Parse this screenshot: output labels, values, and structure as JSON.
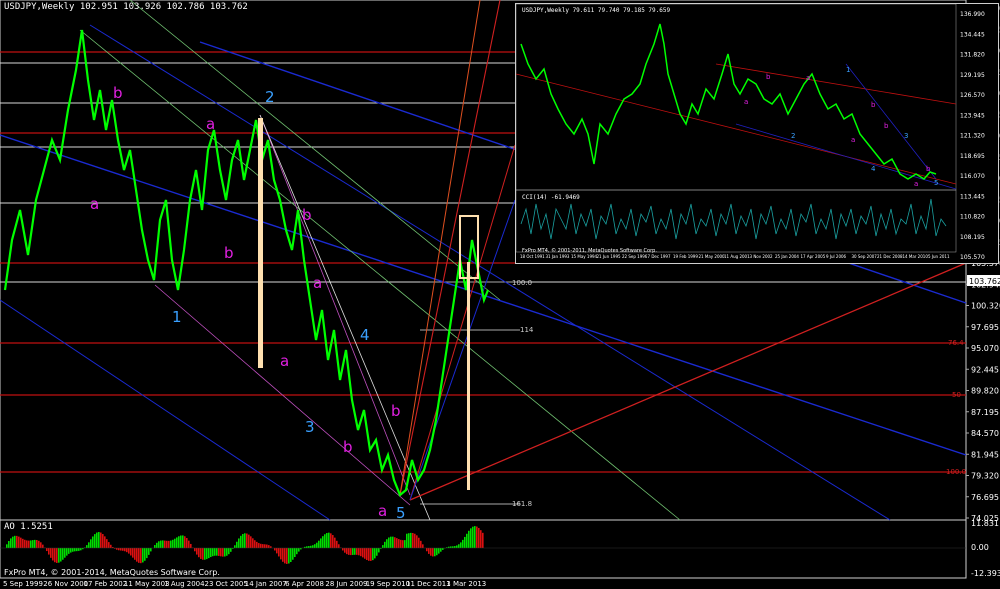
{
  "window": {
    "title": "USDJPY,Weekly  102.951 103.926 102.786 103.762"
  },
  "price_axis": {
    "labels": [
      "136.990",
      "134.445",
      "131.820",
      "129.195",
      "126.570",
      "123.945",
      "121.320",
      "118.695",
      "116.070",
      "113.445",
      "110.820",
      "108.195",
      "105.570",
      "102.945",
      "100.320",
      "97.695",
      "95.070",
      "92.445",
      "89.820",
      "87.195",
      "84.570",
      "81.945",
      "79.320",
      "76.695",
      "74.025"
    ],
    "current_price": "103.762",
    "current_price_color": "#ffffff"
  },
  "ao_axis": {
    "labels": [
      "11.831",
      "0.00",
      "-12.3935"
    ]
  },
  "time_axis": {
    "labels": [
      "5 Sep 1999",
      "26 Nov 2000",
      "17 Feb 2002",
      "11 May 2003",
      "1 Aug 2004",
      "23 Oct 2005",
      "14 Jan 2007",
      "6 Apr 2008",
      "28 Jun 2009",
      "19 Sep 2010",
      "11 Dec 2011",
      "3 Mar 2013"
    ]
  },
  "indicator": {
    "title": "AO 1.5251"
  },
  "footer": {
    "copyright": "FxPro MT4, © 2001-2014, MetaQuotes Software Corp."
  },
  "fib_levels": {
    "level_100": "100.0",
    "level_114": "114",
    "level_76": "76.4",
    "level_61": "61.8",
    "level_50": "50",
    "level_100b": "100.0",
    "level_161": "161.8"
  },
  "wave_labels": {
    "w1": "1",
    "w2": "2",
    "w3": "3",
    "w4": "4",
    "w5": "5",
    "a1": "a",
    "a2": "a",
    "a3": "a",
    "a4": "a",
    "b1": "b",
    "b2": "b",
    "b3": "b",
    "b4": "b",
    "b5": "b"
  },
  "inset": {
    "title": "USDJPY,Weekly  79.611 79.740 79.185 79.659",
    "cci_title": "CCI(14) -61.9469",
    "copyright": "FxPro MT4, © 2001-2011, MetaQuotes Software Corp.",
    "price_labels": [
      "136.990",
      "134.445",
      "131.820",
      "129.195",
      "126.570",
      "123.945",
      "121.320",
      "118.695",
      "116.070",
      "113.445",
      "110.820",
      "108.195",
      "105.570"
    ],
    "time_labels": [
      "18 Oct 1991",
      "31 Jan 1993",
      "15 May 1994",
      "21 Jun 1995",
      "22 Sep 1996",
      "7 Dec 1997",
      "19 Feb 1999",
      "21 May 2000",
      "11 Aug 2001",
      "3 Nov 2002",
      "25 Jan 2004",
      "17 Apr 2005",
      "9 Jul 2006",
      "30 Sep 2007",
      "21 Dec 2008",
      "14 Mar 2010",
      "5 Jun 2011"
    ],
    "wave_labels": [
      "1",
      "2",
      "3",
      "4",
      "5",
      "a",
      "b",
      "a",
      "b",
      "a",
      "b",
      "a",
      "b"
    ]
  },
  "colors": {
    "background": "#000000",
    "candles": "#00ff00",
    "red_line": "#d01010",
    "blue_line": "#1020c0",
    "magenta_label": "#e020e0",
    "cyan_label": "#3aa0ff",
    "fib_bar": "#ffe0b0",
    "cci": "#1aa0a0"
  }
}
